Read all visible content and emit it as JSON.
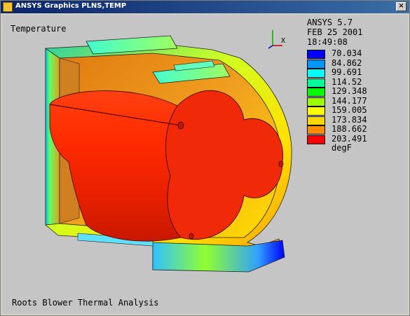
{
  "window": {
    "title": "ANSYS Graphics  PLNS,TEMP",
    "close_label": "×"
  },
  "plot": {
    "label_top_left": "Temperature",
    "footer": "Roots Blower Thermal Analysis",
    "axis_triad_label": "X"
  },
  "info": {
    "program": "ANSYS 5.7",
    "date": "FEB 25 2001",
    "time": "18:49:08"
  },
  "legend": {
    "units": "degF",
    "items": [
      {
        "value": "70.034",
        "color": "#0000ff"
      },
      {
        "value": "84.862",
        "color": "#0096ff"
      },
      {
        "value": "99.691",
        "color": "#00ffff"
      },
      {
        "value": "114.52",
        "color": "#00ff9a"
      },
      {
        "value": "129.348",
        "color": "#00ff00"
      },
      {
        "value": "144.177",
        "color": "#9cff00"
      },
      {
        "value": "159.005",
        "color": "#ffff00"
      },
      {
        "value": "173.834",
        "color": "#ffd700"
      },
      {
        "value": "188.662",
        "color": "#ff8c00"
      },
      {
        "value": "203.491",
        "color": "#ff0000"
      }
    ]
  }
}
